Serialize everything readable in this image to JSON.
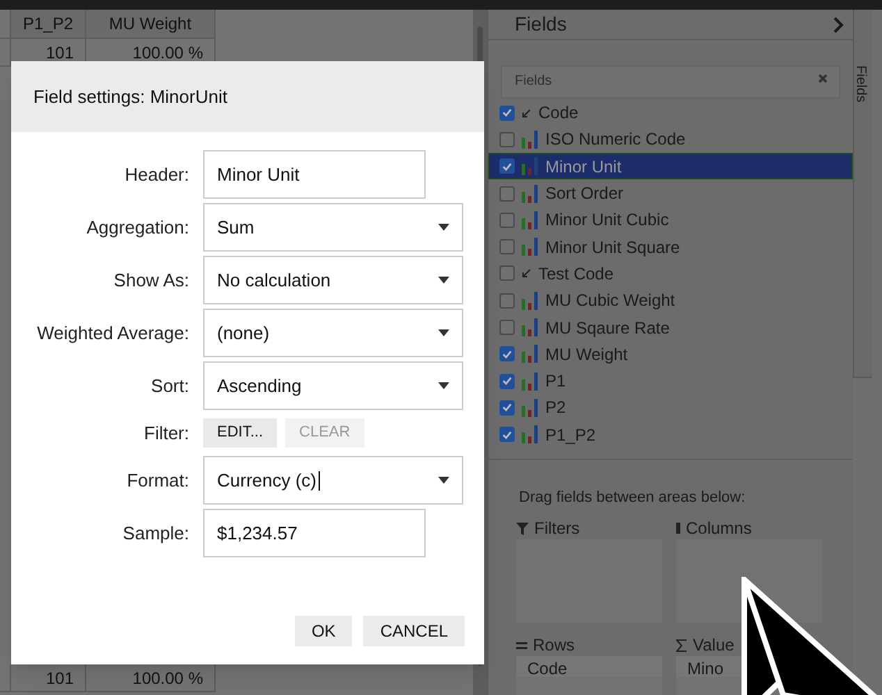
{
  "grid": {
    "columns": [
      "P1_P2",
      "MU Weight"
    ],
    "top_rows": [
      [
        "101",
        "100.00 %"
      ]
    ],
    "bottom_rows": [
      [
        "101",
        "100.00 %"
      ]
    ]
  },
  "dialog": {
    "title": "Field settings: MinorUnit",
    "rows": [
      {
        "kind": "text",
        "label": "Header:",
        "value": "Minor Unit"
      },
      {
        "kind": "select",
        "label": "Aggregation:",
        "value": "Sum"
      },
      {
        "kind": "select",
        "label": "Show As:",
        "value": "No calculation"
      },
      {
        "kind": "select",
        "label": "Weighted Average:",
        "value": "(none)"
      },
      {
        "kind": "select",
        "label": "Sort:",
        "value": "Ascending"
      },
      {
        "kind": "buttons",
        "label": "Filter:",
        "buttons": [
          {
            "label": "EDIT...",
            "disabled": false
          },
          {
            "label": "CLEAR",
            "disabled": true
          }
        ]
      },
      {
        "kind": "select",
        "label": "Format:",
        "value": "Currency (c)",
        "focused": true
      },
      {
        "kind": "text",
        "label": "Sample:",
        "value": "$1,234.57"
      }
    ],
    "buttons": [
      "OK",
      "CANCEL"
    ]
  },
  "panel": {
    "title": "Fields",
    "side_tab": "Fields",
    "search": {
      "placeholder": "Fields"
    },
    "fields": [
      {
        "kind": "dimension",
        "label": "Code",
        "checked": true,
        "selected": false
      },
      {
        "kind": "measure",
        "label": "ISO Numeric Code",
        "checked": false,
        "selected": false
      },
      {
        "kind": "measure",
        "label": "Minor Unit",
        "checked": true,
        "selected": true
      },
      {
        "kind": "measure",
        "label": "Sort Order",
        "checked": false,
        "selected": false
      },
      {
        "kind": "measure",
        "label": "Minor Unit Cubic",
        "checked": false,
        "selected": false
      },
      {
        "kind": "measure",
        "label": "Minor Unit Square",
        "checked": false,
        "selected": false
      },
      {
        "kind": "dimension",
        "label": "Test Code",
        "checked": false,
        "selected": false
      },
      {
        "kind": "measure",
        "label": "MU Cubic Weight",
        "checked": false,
        "selected": false
      },
      {
        "kind": "measure",
        "label": "MU Sqaure Rate",
        "checked": false,
        "selected": false
      },
      {
        "kind": "measure",
        "label": "MU Weight",
        "checked": true,
        "selected": false
      },
      {
        "kind": "measure",
        "label": "P1",
        "checked": true,
        "selected": false
      },
      {
        "kind": "measure",
        "label": "P2",
        "checked": true,
        "selected": false
      },
      {
        "kind": "measure",
        "label": "P1_P2",
        "checked": true,
        "selected": false
      }
    ],
    "areas_hint": "Drag fields between areas below:",
    "areas": [
      {
        "kind": "filters",
        "title": "Filters"
      },
      {
        "kind": "columns",
        "title": "Columns"
      },
      {
        "kind": "rows",
        "title": "Rows",
        "items": [
          "Code"
        ]
      },
      {
        "kind": "values",
        "title": "Value",
        "items": [
          "Mino"
        ]
      }
    ]
  }
}
